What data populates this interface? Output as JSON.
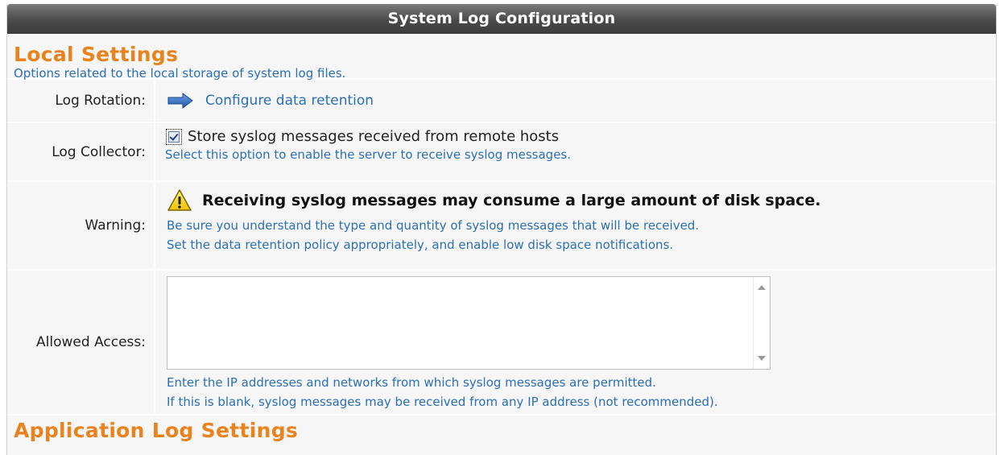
{
  "window": {
    "title": "System Log Configuration"
  },
  "local_settings": {
    "heading": "Local Settings",
    "description": "Options related to the local storage of system log files."
  },
  "rows": {
    "log_rotation": {
      "label": "Log Rotation:",
      "link_text": "Configure data retention",
      "icon": "right-arrow-icon"
    },
    "log_collector": {
      "label": "Log Collector:",
      "checkbox_label": "Store syslog messages received from remote hosts",
      "checked": true,
      "help": "Select this option to enable the server to receive syslog messages."
    },
    "warning": {
      "label": "Warning:",
      "icon": "warning-icon",
      "headline": "Receiving syslog messages may consume a large amount of disk space.",
      "line1": "Be sure you understand the type and quantity of syslog messages that will be received.",
      "line2": "Set the data retention policy appropriately, and enable low disk space notifications."
    },
    "allowed_access": {
      "label": "Allowed Access:",
      "value": "",
      "help1": "Enter the IP addresses and networks from which syslog messages are permitted.",
      "help2": "If this is blank, syslog messages may be received from any IP address (not recommended)."
    }
  },
  "application_settings": {
    "heading": "Application Log Settings"
  },
  "colors": {
    "accent_orange": "#e8831d",
    "link_blue": "#2b6fb6",
    "title_bar": "#4a4a4a"
  }
}
